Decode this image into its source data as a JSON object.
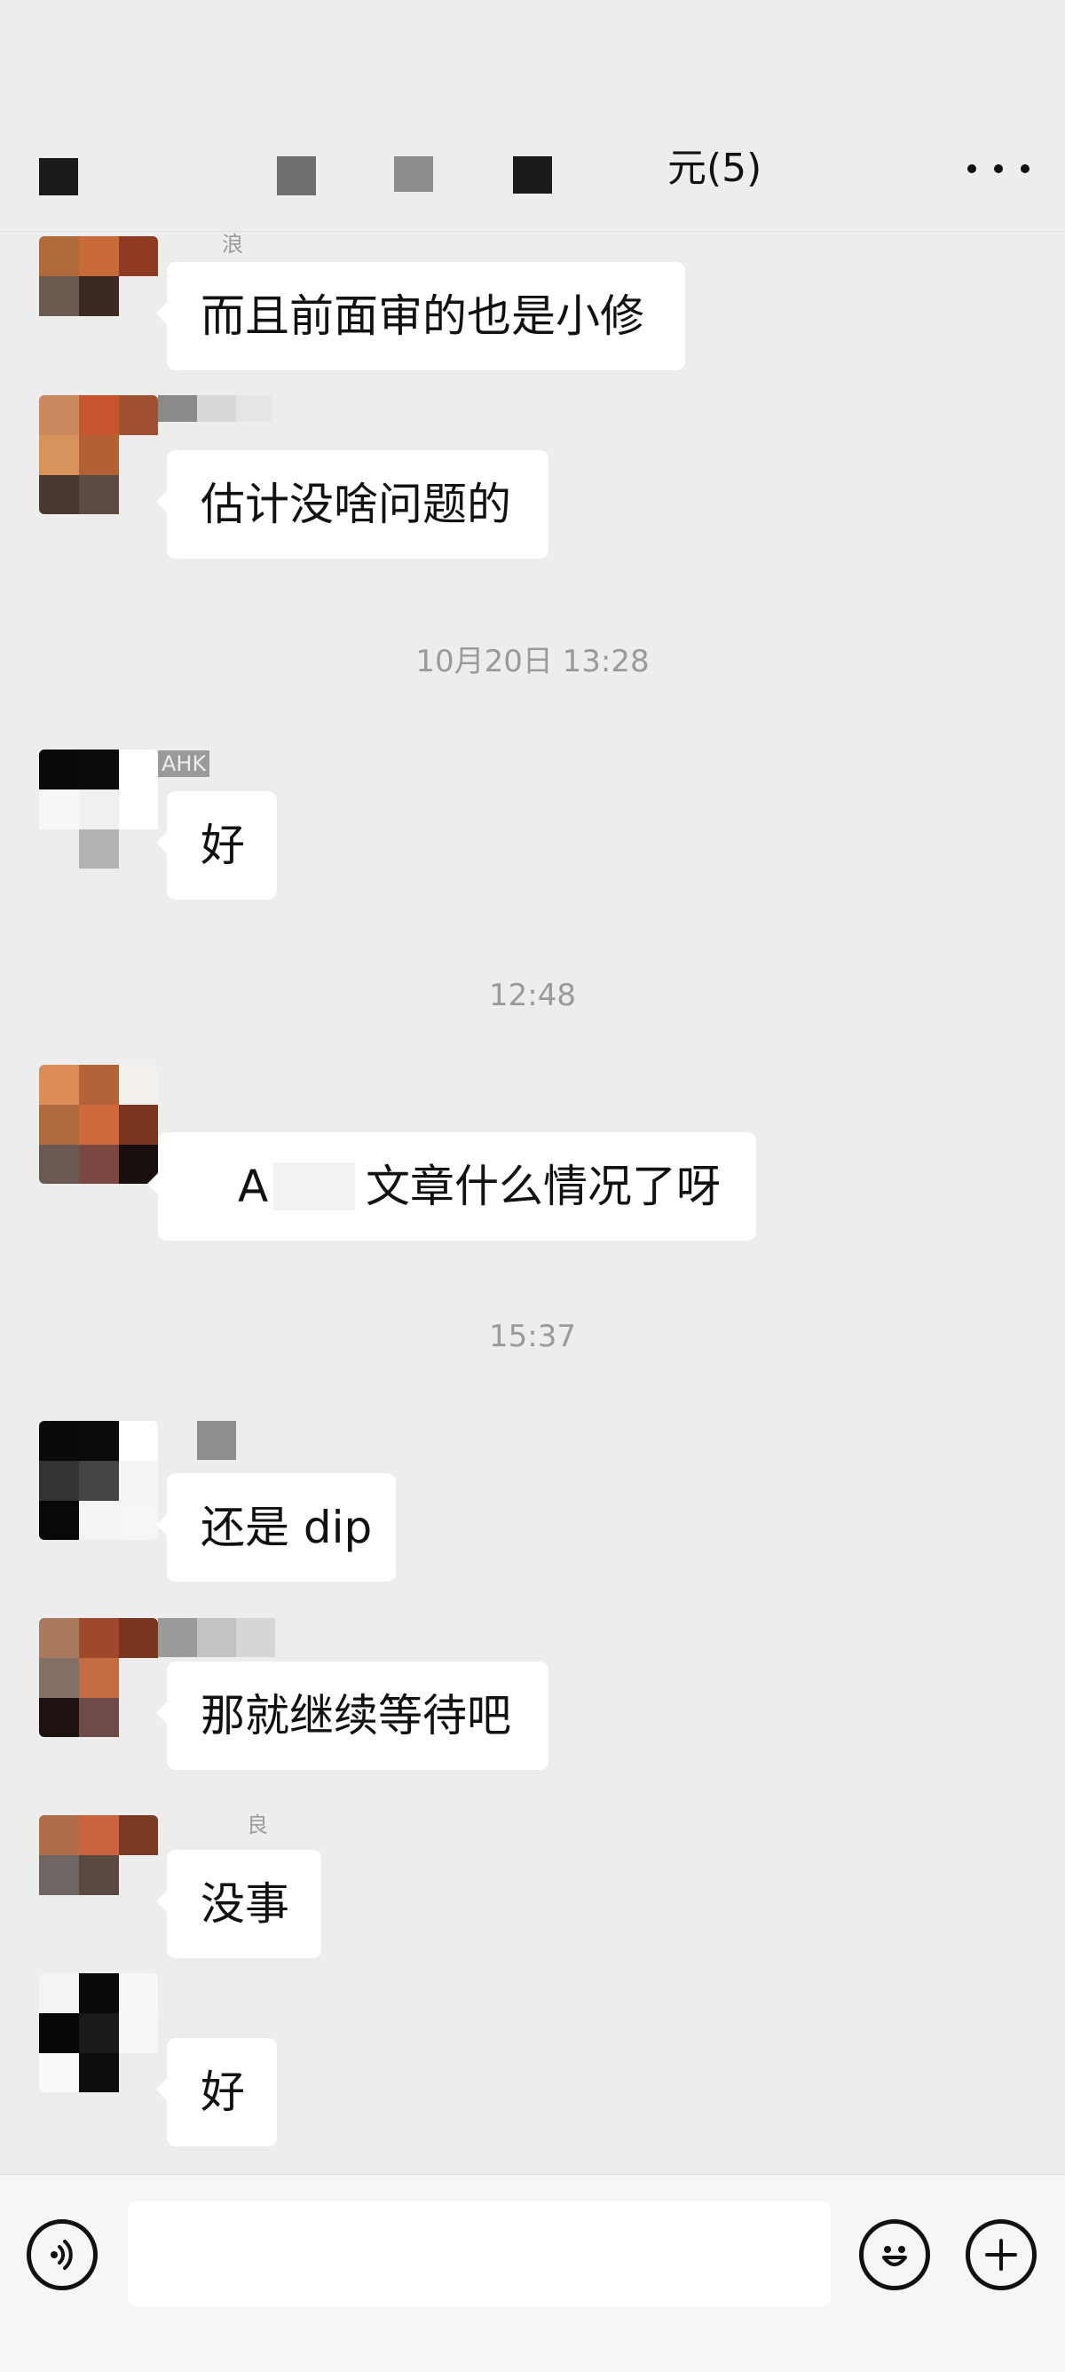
{
  "header": {
    "title": "元(5)",
    "more_icon": "more-dots-icon"
  },
  "messages": [
    {
      "name": "浪",
      "text": "而且前面审的也是小修"
    },
    {
      "name": "",
      "text": "估计没啥问题的"
    },
    {
      "timestamp": "10月20日 13:28"
    },
    {
      "name": "AHK",
      "text": "好"
    },
    {
      "timestamp": "12:48"
    },
    {
      "name": "",
      "text_prefix": "A",
      "text": "文章什么情况了呀"
    },
    {
      "timestamp": "15:37"
    },
    {
      "name": "",
      "text": "还是 dip"
    },
    {
      "name": "",
      "text": "那就继续等待吧"
    },
    {
      "name": "良",
      "text": "没事"
    },
    {
      "name": "",
      "text": "好"
    }
  ],
  "input_bar": {
    "voice_icon": "voice-icon",
    "emoji_icon": "emoji-icon",
    "plus_icon": "plus-icon",
    "message_value": ""
  }
}
